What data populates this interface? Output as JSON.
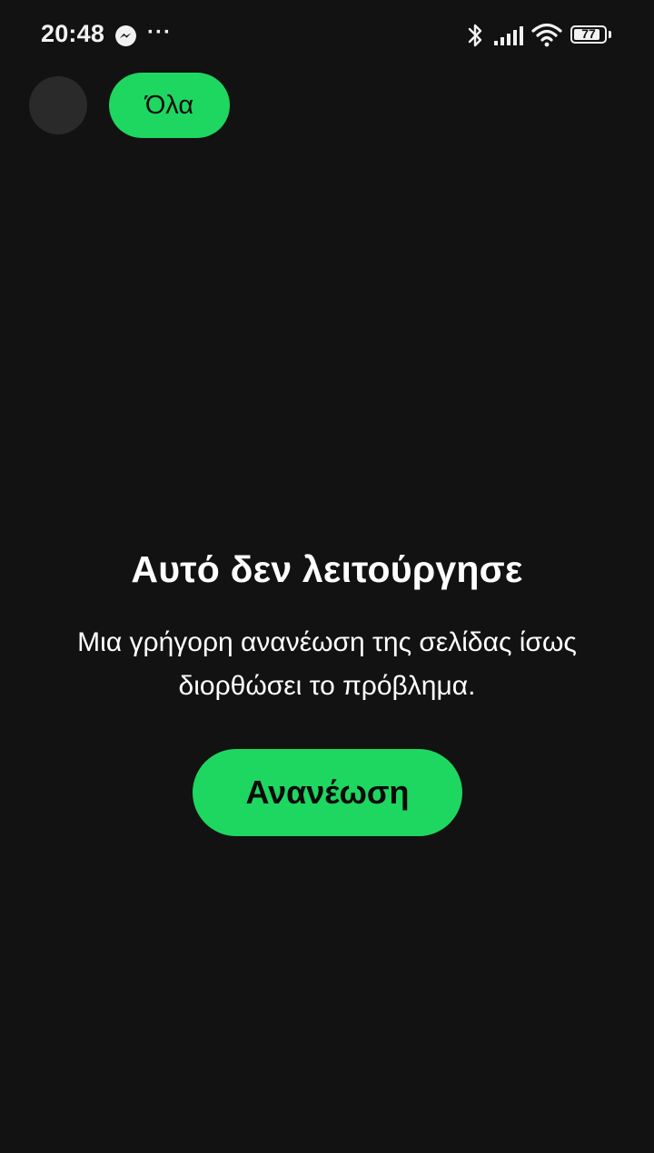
{
  "status_bar": {
    "time": "20:48",
    "more": "···",
    "battery_level": "77",
    "icons": [
      "messenger-icon",
      "bluetooth-icon",
      "signal-icon",
      "wifi-icon",
      "battery-icon"
    ]
  },
  "filters": {
    "chips": [
      {
        "label": "Όλα",
        "selected": true
      }
    ]
  },
  "error": {
    "title": "Αυτό δεν λειτούργησε",
    "message_line1": "Μια γρήγορη ανανέωση της σελίδας ίσως",
    "message_line2": "διορθώσει το πρόβλημα.",
    "refresh_label": "Ανανέωση"
  },
  "colors": {
    "background": "#121212",
    "accent": "#1ed760",
    "avatar_placeholder": "#2a2a2a"
  }
}
